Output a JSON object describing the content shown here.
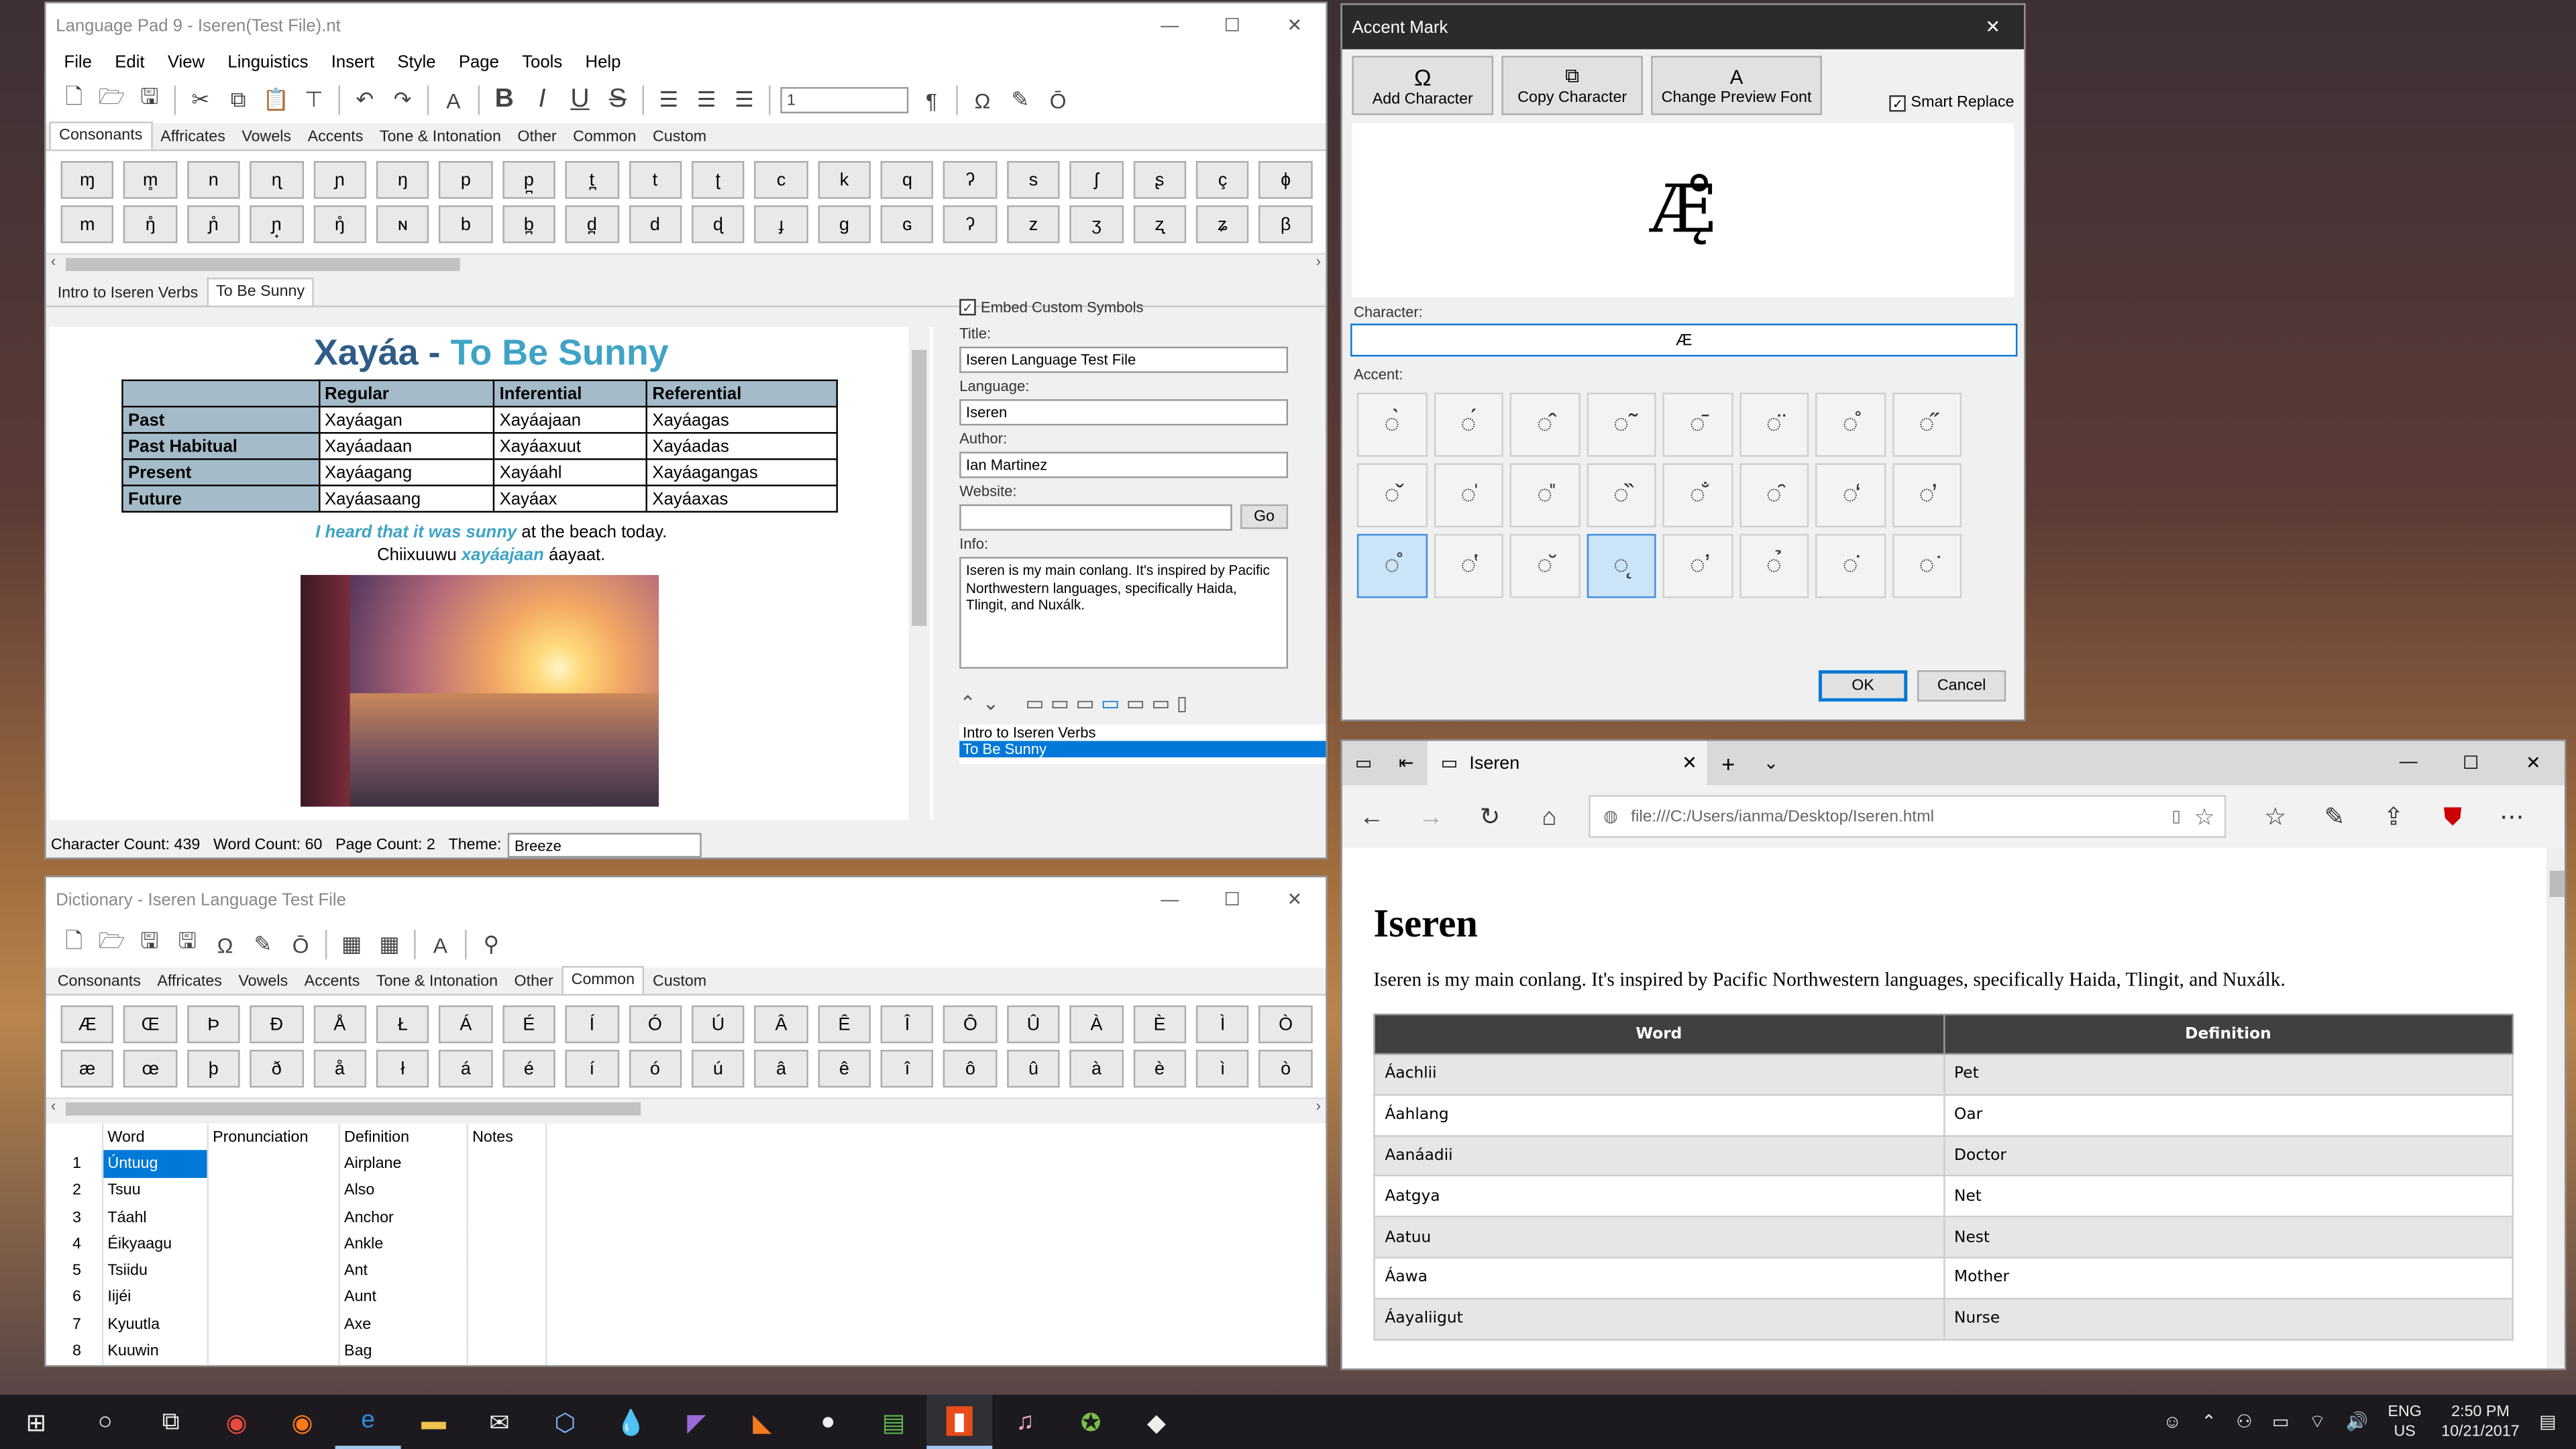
{
  "lp": {
    "title": "Language Pad 9 - Iseren(Test File).nt",
    "menu": [
      "File",
      "Edit",
      "View",
      "Linguistics",
      "Insert",
      "Style",
      "Page",
      "Tools",
      "Help"
    ],
    "font_size": "1",
    "char_tabs": [
      "Consonants",
      "Affricates",
      "Vowels",
      "Accents",
      "Tone & Intonation",
      "Other",
      "Common",
      "Custom"
    ],
    "row1": [
      "ɱ",
      "m̥",
      "n",
      "ɳ",
      "ɲ",
      "ŋ",
      "p",
      "p̪",
      "t̪",
      "t",
      "ʈ",
      "c",
      "k",
      "q",
      "ʔ",
      "s",
      "ʃ",
      "ʂ",
      "ç",
      "ɸ"
    ],
    "row2": [
      "m",
      "ŋ̊",
      "ɲ̊",
      "ɲ̟",
      "ŋ̊",
      "ɴ",
      "b",
      "b̪",
      "d̪",
      "d",
      "ɖ",
      "ɟ",
      "g",
      "ɢ",
      "ʔ",
      "z",
      "ʒ",
      "ʐ",
      "ʑ",
      "β"
    ],
    "page_tabs": [
      "Intro to Iseren Verbs",
      "To Be Sunny"
    ],
    "doc_title_a": "Xayáa - ",
    "doc_title_b": "To Be Sunny",
    "table_head": [
      "",
      "Regular",
      "Inferential",
      "Referential"
    ],
    "table_rows": [
      [
        "Past",
        "Xayáagan",
        "Xayáajaan",
        "Xayáagas"
      ],
      [
        "Past Habitual",
        "Xayáadaan",
        "Xayáaxuut",
        "Xayáadas"
      ],
      [
        "Present",
        "Xayáagang",
        "Xayáahl",
        "Xayáagangas"
      ],
      [
        "Future",
        "Xayáasaang",
        "Xayáax",
        "Xayáaxas"
      ]
    ],
    "sent1_a": "I heard that it was sunny",
    "sent1_b": " at the beach today.",
    "sent2_a": "Chiixuuwu ",
    "sent2_b": "xayáajaan",
    "sent2_c": " áayaat.",
    "embed": "Embed Custom Symbols",
    "title_lbl": "Title:",
    "title_val": "Iseren Language Test File",
    "lang_lbl": "Language:",
    "lang_val": "Iseren",
    "author_lbl": "Author:",
    "author_val": "Ian Martinez",
    "web_lbl": "Website:",
    "web_val": "",
    "go": "Go",
    "info_lbl": "Info:",
    "info_val": "Iseren is my main conlang. It's inspired by Pacific Northwestern languages, specifically Haida, Tlingit, and Nuxálk.",
    "pages": [
      "Intro to Iseren Verbs",
      "To Be Sunny"
    ],
    "status": {
      "chars": "Character Count: 439",
      "words": "Word Count: 60",
      "pages": "Page Count: 2",
      "theme_lbl": "Theme:",
      "theme": "Breeze"
    }
  },
  "dict": {
    "title": "Dictionary - Iseren Language Test File",
    "tabs": [
      "Consonants",
      "Affricates",
      "Vowels",
      "Accents",
      "Tone & Intonation",
      "Other",
      "Common",
      "Custom"
    ],
    "row1": [
      "Æ",
      "Œ",
      "Þ",
      "Ð",
      "Å",
      "Ł",
      "Á",
      "É",
      "Í",
      "Ó",
      "Ú",
      "Â",
      "Ê",
      "Î",
      "Ô",
      "Û",
      "À",
      "È",
      "Ì",
      "Ò"
    ],
    "row2": [
      "æ",
      "œ",
      "þ",
      "ð",
      "å",
      "ł",
      "á",
      "é",
      "í",
      "ó",
      "ú",
      "â",
      "ê",
      "î",
      "ô",
      "û",
      "à",
      "è",
      "ì",
      "ò"
    ],
    "cols": [
      "Word",
      "Pronunciation",
      "Definition",
      "Notes"
    ],
    "rows": [
      [
        "1",
        "Úntuug",
        "",
        "Airplane"
      ],
      [
        "2",
        "Tsuu",
        "",
        "Also"
      ],
      [
        "3",
        "Táahl",
        "",
        "Anchor"
      ],
      [
        "4",
        "Éikyaagu",
        "",
        "Ankle"
      ],
      [
        "5",
        "Tsiidu",
        "",
        "Ant"
      ],
      [
        "6",
        "Iijéi",
        "",
        "Aunt"
      ],
      [
        "7",
        "Kyuutla",
        "",
        "Axe"
      ],
      [
        "8",
        "Kuuwin",
        "",
        "Bag"
      ]
    ]
  },
  "accent": {
    "title": "Accent Mark",
    "btn_add": "Add Character",
    "btn_copy": "Copy Character",
    "btn_font": "Change Preview Font",
    "smart": "Smart Replace",
    "preview": "Æ̨̊",
    "char_lbl": "Character:",
    "char_val": "Æ",
    "accent_lbl": "Accent:",
    "marks": [
      "◌̀",
      "◌́",
      "◌̂",
      "◌̃",
      "◌̄",
      "◌̈",
      "◌̊",
      "◌̋",
      "◌̌",
      "◌̍",
      "◌̎",
      "◌̏",
      "◌̐",
      "◌̑",
      "◌̒",
      "◌̓",
      "◌̊",
      "◌̔",
      "◌̆",
      "◌̨",
      "◌̛",
      "◌̉",
      "◌̇",
      "◌͘"
    ],
    "ok": "OK",
    "cancel": "Cancel"
  },
  "edge": {
    "tab": "Iseren",
    "url": "file:///C:/Users/ianma/Desktop/Iseren.html",
    "h1": "Iseren",
    "intro": "Iseren is my main conlang. It's inspired by Pacific Northwestern languages, specifically Haida, Tlingit, and Nuxálk.",
    "cols": [
      "Word",
      "Definition"
    ],
    "rows": [
      [
        "Áachlii",
        "Pet"
      ],
      [
        "Áahlang",
        "Oar"
      ],
      [
        "Aanáadii",
        "Doctor"
      ],
      [
        "Aatgya",
        "Net"
      ],
      [
        "Aatuu",
        "Nest"
      ],
      [
        "Áawa",
        "Mother"
      ],
      [
        "Áayaliigut",
        "Nurse"
      ]
    ]
  },
  "taskbar": {
    "lang1": "ENG",
    "lang2": "US",
    "time": "2:50 PM",
    "date": "10/21/2017"
  },
  "colors": {
    "accent": "#0078d7",
    "header_cell": "#a5bbc9",
    "doc_title": "#2f5c86",
    "doc_title_b": "#3fa3c6"
  }
}
